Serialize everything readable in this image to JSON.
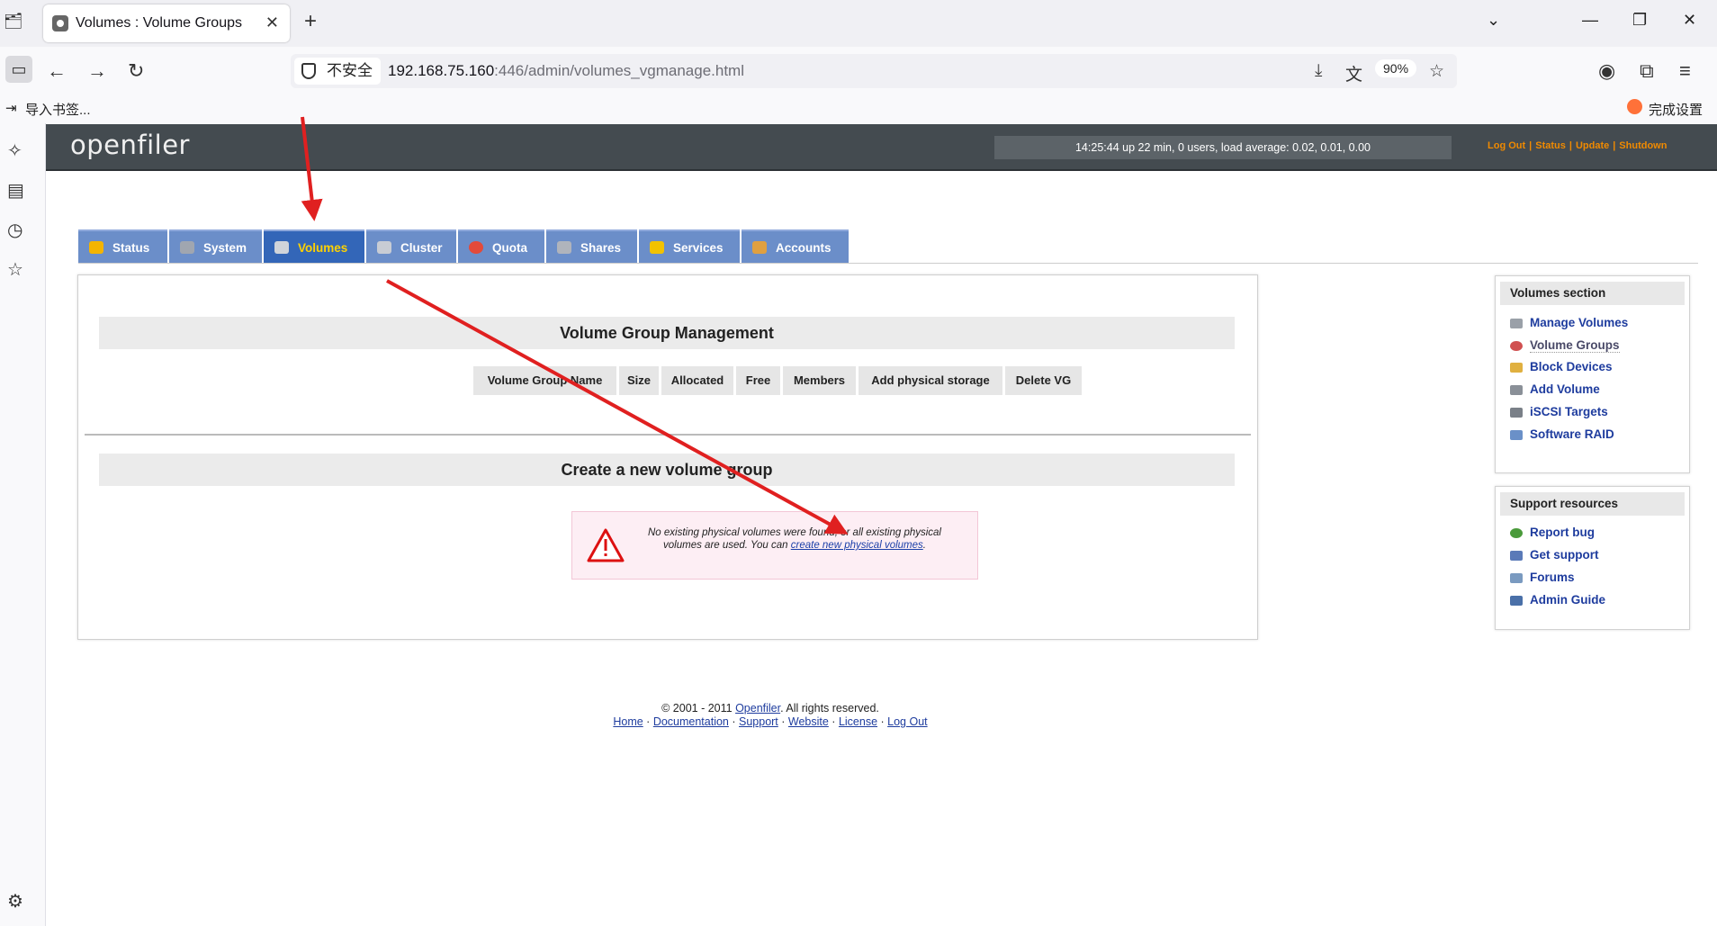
{
  "browser": {
    "tab_title": "Volumes : Volume Groups",
    "security_label": "不安全",
    "url_host": "192.168.75.160",
    "url_rest": ":446/admin/volumes_vgmanage.html",
    "zoom": "90%",
    "bookmark_import": "导入书签...",
    "setup_label": "完成设置"
  },
  "header": {
    "logo": "openfiler",
    "status_line": "14:25:44 up 22 min, 0 users, load average: 0.02, 0.01, 0.00",
    "links": [
      "Log Out",
      "Status",
      "Update",
      "Shutdown"
    ]
  },
  "nav_tabs": [
    {
      "label": "Status",
      "color": "#f4b400"
    },
    {
      "label": "System",
      "color": "#a0a6b0"
    },
    {
      "label": "Volumes",
      "color": "#d0d4da",
      "active": true
    },
    {
      "label": "Cluster",
      "color": "#c8ccd4"
    },
    {
      "label": "Quota",
      "color": "#e34a3a"
    },
    {
      "label": "Shares",
      "color": "#b0b4bc"
    },
    {
      "label": "Services",
      "color": "#f2c200"
    },
    {
      "label": "Accounts",
      "color": "#e0a040"
    }
  ],
  "main": {
    "vg_heading": "Volume Group Management",
    "table_headers": [
      "Volume Group Name",
      "Size",
      "Allocated",
      "Free",
      "Members",
      "Add physical storage",
      "Delete VG"
    ],
    "create_heading": "Create a new volume group",
    "alert_text_1": "No existing physical volumes were found, or all existing physical volumes are used. You can ",
    "alert_link": "create new physical volumes",
    "alert_text_2": "."
  },
  "volumes_section": {
    "title": "Volumes section",
    "items": [
      {
        "label": "Manage Volumes",
        "color": "#9aa0a8"
      },
      {
        "label": "Volume Groups",
        "color": "#d05050",
        "current": true
      },
      {
        "label": "Block Devices",
        "color": "#e0b040"
      },
      {
        "label": "Add Volume",
        "color": "#8a9098"
      },
      {
        "label": "iSCSI Targets",
        "color": "#7a8088"
      },
      {
        "label": "Software RAID",
        "color": "#6a90c8"
      }
    ]
  },
  "support_section": {
    "title": "Support resources",
    "items": [
      {
        "label": "Report bug",
        "color": "#4a9a3a"
      },
      {
        "label": "Get support",
        "color": "#5a7ab8"
      },
      {
        "label": "Forums",
        "color": "#7a9ac0"
      },
      {
        "label": "Admin Guide",
        "color": "#4a70a8"
      }
    ]
  },
  "footer": {
    "copyright_prefix": "© 2001 - 2011 ",
    "copyright_link": "Openfiler",
    "copyright_suffix": ". All rights reserved.",
    "links": [
      "Home",
      "Documentation",
      "Support",
      "Website",
      "License",
      "Log Out"
    ]
  }
}
